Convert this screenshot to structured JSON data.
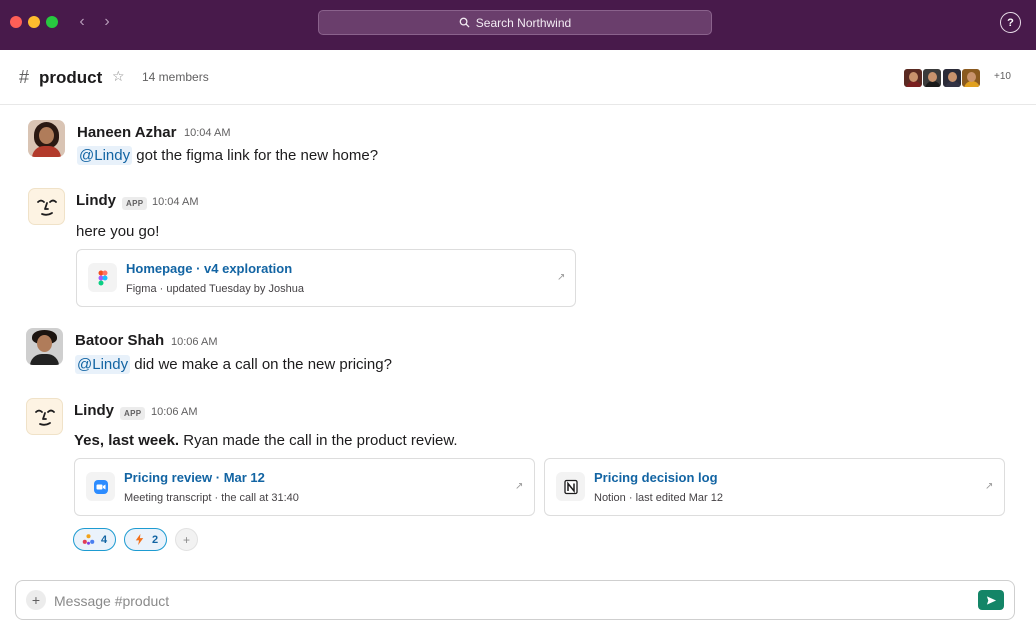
{
  "window": {
    "search_placeholder": "Search Northwind",
    "help_label": "?"
  },
  "channel": {
    "hash": "#",
    "name": "product",
    "members": "14 members",
    "extra_members": "+10"
  },
  "messages": [
    {
      "sender": "Haneen Azhar",
      "time": "10:04 AM",
      "mention": "@Lindy",
      "text": " got the figma link for the new home?"
    },
    {
      "sender": "Lindy",
      "badge": "APP",
      "time": "10:04 AM",
      "text": "here you go!",
      "card": {
        "title": "Homepage · v4 exploration",
        "subtitle": "Figma · updated Tuesday by Joshua",
        "icon": "figma-icon"
      }
    },
    {
      "sender": "Batoor Shah",
      "time": "10:06 AM",
      "mention": "@Lindy",
      "text": " did we make a call on the new pricing?"
    },
    {
      "sender": "Lindy",
      "badge": "APP",
      "time": "10:06 AM",
      "bold_text": "Yes, last week.",
      "text": " Ryan made the call in the product review.",
      "cards": [
        {
          "title": "Pricing review · Mar 12",
          "subtitle": "Meeting transcript · the call at 31:40",
          "icon": "zoom-icon"
        },
        {
          "title": "Pricing decision log",
          "subtitle": "Notion · last edited Mar 12",
          "icon": "notion-icon"
        }
      ],
      "reactions": [
        {
          "icon": "people-icon",
          "count": "4"
        },
        {
          "icon": "lightning-icon",
          "count": "2"
        }
      ]
    }
  ],
  "composer": {
    "placeholder": "Message #product"
  },
  "colors": {
    "titlebar": "#481a4b",
    "link": "#1264a3",
    "send": "#148567"
  }
}
